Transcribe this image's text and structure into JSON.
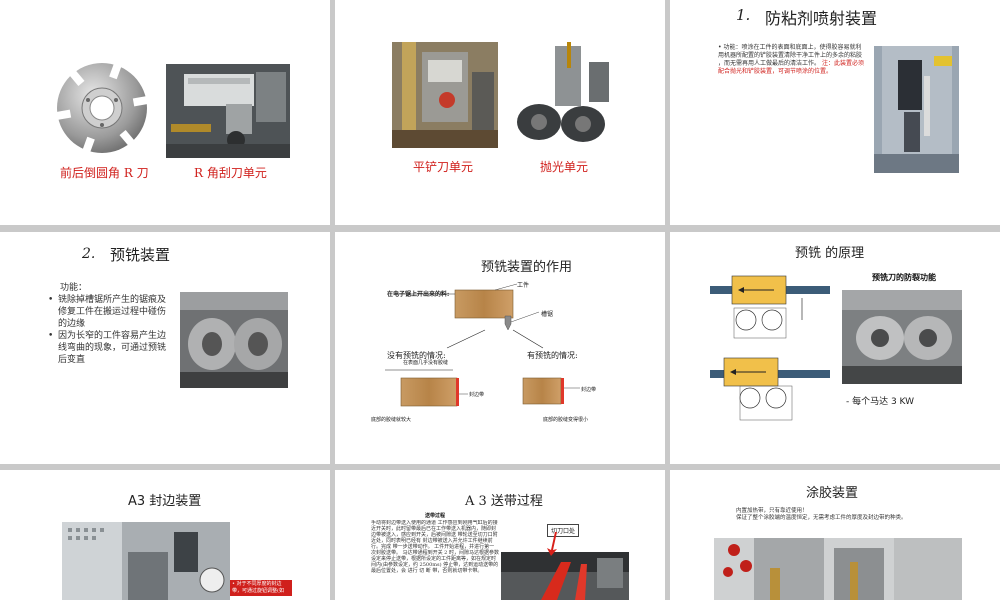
{
  "slides": {
    "s1": {
      "caption_left": "前后倒圆角 R 刀",
      "caption_right": "R 角刮刀单元"
    },
    "s2": {
      "caption_left": "平铲刀单元",
      "caption_right": "抛光单元"
    },
    "s3": {
      "number": "1.",
      "title": "防粘剂喷射装置",
      "body_a": "功能：喷涂在工件的表面和底面上，使得胶容易就利用机器所配置的铲胶装置清除干净工件上的多余的粘胶",
      "body_b": "，而无需再用人工做最后的清洁工作。",
      "body_note": "注：此装置必须配合抛光和铲胶装置，可调节喷涂的位置。"
    },
    "s4": {
      "number": "2.",
      "title": "预铣装置",
      "label": "功能：",
      "bullets": [
        "铣除掉槽锯所产生的锯痕及修复工件在搬运过程中碰伤的边缘",
        "因为长窄的工件容易产生边线弯曲的现象，可通过预铣后变直"
      ]
    },
    "s5": {
      "title": "预铣装置的作用",
      "from_saw": "在电子锯上开出来的料:",
      "workpiece": "工件",
      "slot": "槽锯",
      "without": "没有预铣的情况:",
      "without_sub": "在表面几乎没有胶缝",
      "with": "有预铣的情况:",
      "edge_band_left": "封边带",
      "edge_band_right": "封边带",
      "bottom_left": "底部的胶缝就较大",
      "bottom_right": "底部的胶缝变得很小"
    },
    "s6": {
      "title": "预铣 的原理",
      "subtitle": "预铣刀的防裂功能",
      "note": "-  每个马达   3 KW"
    },
    "s7": {
      "title": "A3 封边装置",
      "note": "• 对于不同厚度的封边带，可通过旋钮调整(如"
    },
    "s8": {
      "title": "A 3 送带过程",
      "sub": "送带过程",
      "body": "手动将封边带送入使用的通道 工作感应到刚用气缸后的接近开关时，此时留带最后已在工作带送入机器内，随即封边带被送入，感应到开关，后被间隙送 带轮送至切刀口附近处，同时表明已经有 封边带被送入并允许工件继续前行。完成 带一步送带动作。 工件开始进程，并进行第一次封胶送带。 马达带通程到开关 2 时，间隙马达根据参数 设定来停止送带，根据所设定的工件距离等，如在规定时间内(由参数设定，约 2500ms) 停止带，达到运动送带的最后位置处，会 进行 切 断 带，否则就切带卡带。",
      "callout": "切刀口处"
    },
    "s9": {
      "title": "涂胶装置",
      "body_a": "内置加热带，只有靠近使用！",
      "body_b": "保证了整个涂胶端的温度恒定，无需考虑工件的厚度及封边带的种类。"
    }
  }
}
